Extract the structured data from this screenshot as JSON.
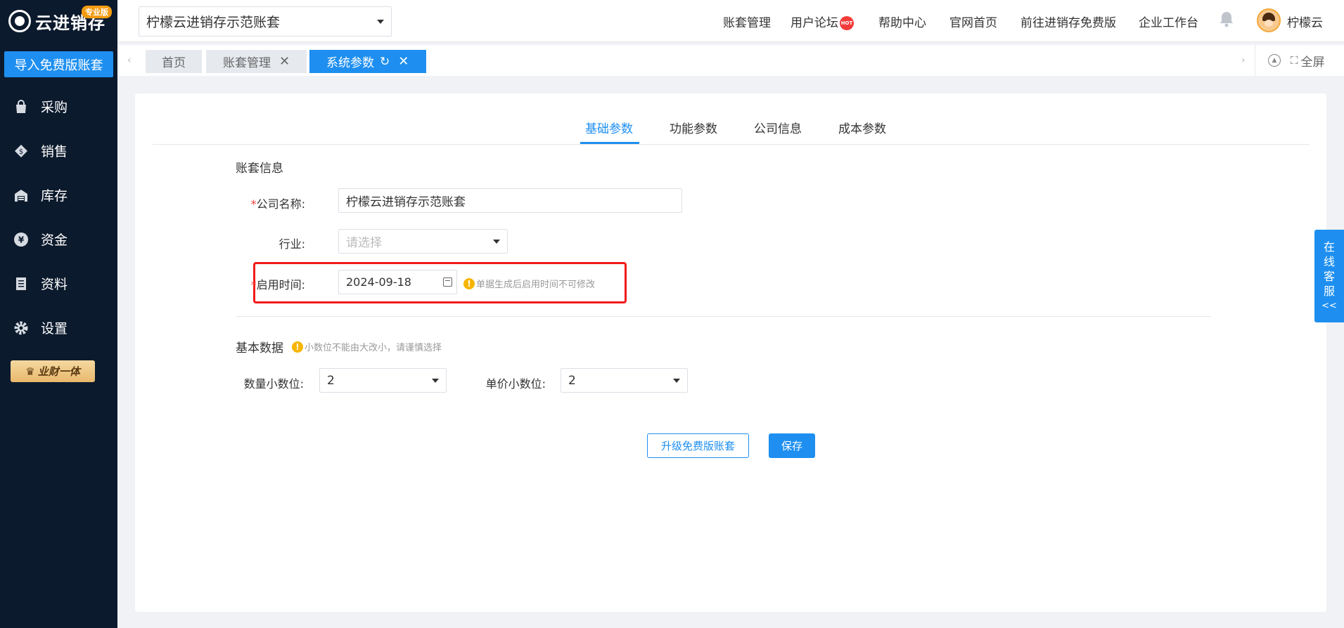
{
  "brand": {
    "name": "云进销存",
    "badge": "专业版"
  },
  "sidebar": {
    "import_button": "导入免费版账套",
    "items": [
      {
        "label": "采购",
        "icon": "bag-icon"
      },
      {
        "label": "销售",
        "icon": "tag-icon"
      },
      {
        "label": "库存",
        "icon": "warehouse-icon"
      },
      {
        "label": "资金",
        "icon": "yen-icon"
      },
      {
        "label": "资料",
        "icon": "document-icon"
      },
      {
        "label": "设置",
        "icon": "gear-icon"
      }
    ],
    "promo": "业财一体"
  },
  "topbar": {
    "account_select": "柠檬云进销存示范账套",
    "links": [
      "账套管理",
      "用户论坛",
      "帮助中心",
      "官网首页",
      "前往进销存免费版",
      "企业工作台"
    ],
    "hot_badge": "HOT",
    "username": "柠檬云"
  },
  "page_tabs": [
    {
      "label": "首页"
    },
    {
      "label": "账套管理"
    },
    {
      "label": "系统参数"
    }
  ],
  "fullscreen_label": "全屏",
  "form_tabs": [
    "基础参数",
    "功能参数",
    "公司信息",
    "成本参数"
  ],
  "form": {
    "account_info_title": "账套信息",
    "company_label": "公司名称:",
    "company_value": "柠檬云进销存示范账套",
    "industry_label": "行业:",
    "industry_placeholder": "请选择",
    "start_label": "启用时间:",
    "start_value": "2024-09-18",
    "start_hint": "单据生成后启用时间不可修改",
    "basic_title": "基本数据",
    "basic_hint": "小数位不能由大改小，请谨慎选择",
    "qty_label": "数量小数位:",
    "qty_value": "2",
    "price_label": "单价小数位:",
    "price_value": "2",
    "upgrade_button": "升级免费版账套",
    "save_button": "保存"
  },
  "service": [
    "在",
    "线",
    "客",
    "服",
    "<<"
  ],
  "colors": {
    "primary": "#1e8ff0",
    "sidebar": "#0c1a2d",
    "highlight": "#f11a1a",
    "warning": "#f7b500"
  }
}
